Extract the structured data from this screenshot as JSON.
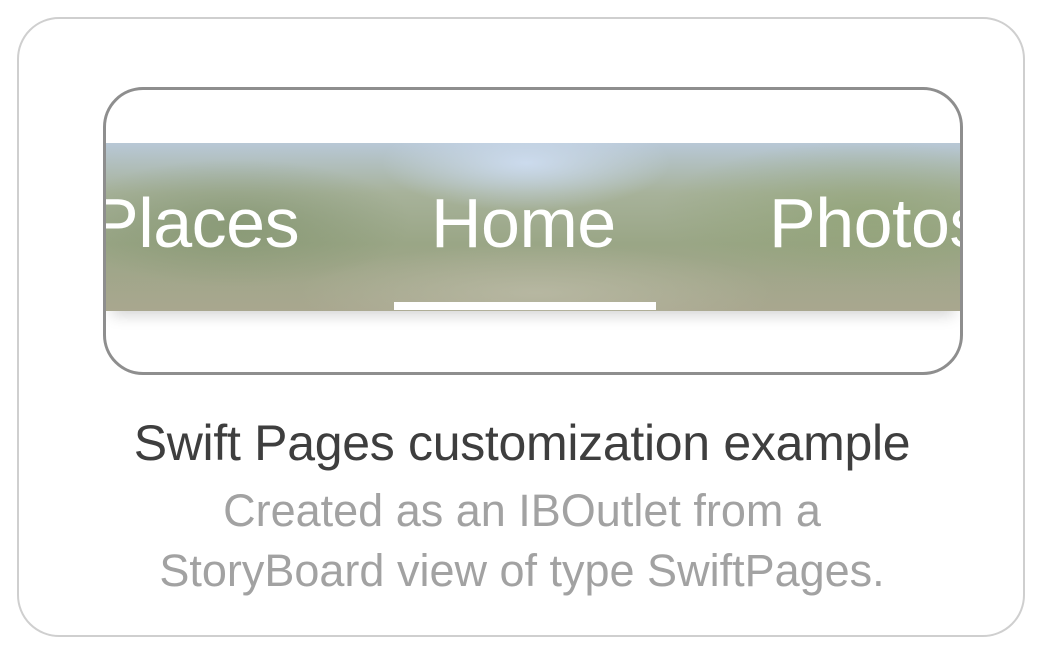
{
  "tabs": [
    {
      "label": "Places",
      "selected": false
    },
    {
      "label": "Home",
      "selected": true
    },
    {
      "label": "Photos",
      "selected": false
    }
  ],
  "caption": {
    "title": "Swift Pages customization example",
    "subtitle_line1": "Created as an IBOutlet from a",
    "subtitle_line2": "StoryBoard view of type SwiftPages."
  },
  "colors": {
    "tab_text": "#ffffff",
    "indicator": "#ffffff",
    "title": "#3e3e3e",
    "subtitle": "#a2a2a2",
    "device_border": "#8e8e8e",
    "card_border": "#cfcfcf"
  }
}
